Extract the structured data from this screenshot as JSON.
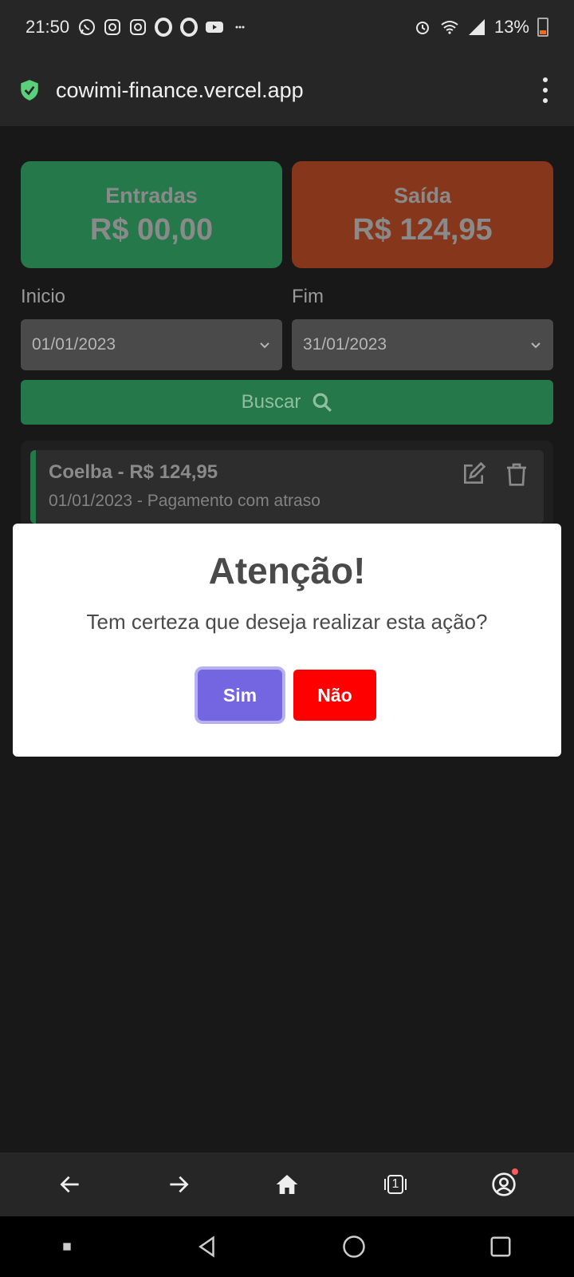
{
  "status_bar": {
    "time": "21:50",
    "battery": "13%",
    "icons_left": [
      "whatsapp-icon",
      "instagram-icon",
      "instagram-icon",
      "opera-icon",
      "opera-icon",
      "youtube-icon",
      "more-dots-icon"
    ],
    "icons_right": [
      "alarm-icon",
      "wifi-icon",
      "signal-icon",
      "battery-icon"
    ]
  },
  "browser": {
    "url": "cowimi-finance.vercel.app",
    "tab_count": "1"
  },
  "summary": {
    "income_label": "Entradas",
    "income_value": "R$ 00,00",
    "expense_label": "Saída",
    "expense_value": "R$ 124,95"
  },
  "filters": {
    "start_label": "Inicio",
    "start_value": "01/01/2023",
    "end_label": "Fim",
    "end_value": "31/01/2023",
    "search_label": "Buscar"
  },
  "transactions": [
    {
      "title": "Coelba - R$ 124,95",
      "subtitle": "01/01/2023 - Pagamento com atraso"
    }
  ],
  "modal": {
    "title": "Atenção!",
    "message": "Tem certeza que deseja realizar esta ação?",
    "confirm_label": "Sim",
    "cancel_label": "Não"
  },
  "colors": {
    "income": "#24784a",
    "expense": "#86361a",
    "confirm": "#7366e0",
    "cancel": "#ff0000"
  }
}
